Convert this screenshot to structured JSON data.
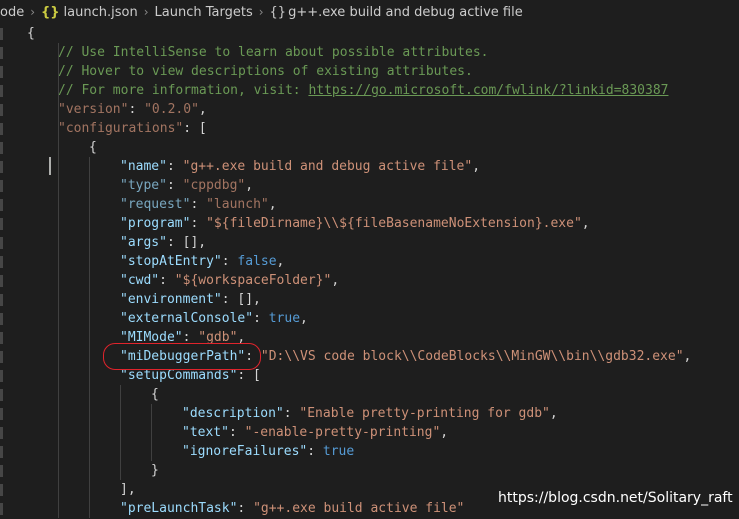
{
  "breadcrumb": {
    "items": [
      "ode",
      "launch.json",
      "Launch Targets",
      "g++.exe build and debug active file"
    ],
    "json_icon": "{}",
    "object_icon": "{}",
    "separator": "›"
  },
  "editor": {
    "lines": [
      {
        "i": 0,
        "p": [
          [
            "punc",
            "{"
          ]
        ]
      },
      {
        "i": 1,
        "p": [
          [
            "cmt",
            "// Use IntelliSense to learn about possible attributes."
          ]
        ]
      },
      {
        "i": 1,
        "p": [
          [
            "cmt",
            "// Hover to view descriptions of existing attributes."
          ]
        ]
      },
      {
        "i": 1,
        "p": [
          [
            "cmt",
            "// For more information, visit: "
          ],
          [
            "link",
            "https://go.microsoft.com/fwlink/?linkid=830387"
          ]
        ]
      },
      {
        "i": 1,
        "p": [
          [
            "str-dim",
            "\"version\""
          ],
          [
            "punc",
            ": "
          ],
          [
            "str-dim",
            "\"0.2.0\""
          ],
          [
            "punc",
            ","
          ]
        ]
      },
      {
        "i": 1,
        "p": [
          [
            "str-dim",
            "\"configurations\""
          ],
          [
            "punc",
            ": ["
          ]
        ]
      },
      {
        "i": 2,
        "p": [
          [
            "punc",
            "{"
          ]
        ]
      },
      {
        "i": 3,
        "p": [
          [
            "key",
            "\"name\""
          ],
          [
            "punc",
            ": "
          ],
          [
            "str",
            "\"g++.exe build and debug active file\""
          ],
          [
            "punc",
            ","
          ]
        ]
      },
      {
        "i": 3,
        "p": [
          [
            "key-dim",
            "\"type\""
          ],
          [
            "punc",
            ": "
          ],
          [
            "str-dim",
            "\"cppdbg\""
          ],
          [
            "punc",
            ","
          ]
        ]
      },
      {
        "i": 3,
        "p": [
          [
            "key-dim",
            "\"request\""
          ],
          [
            "punc",
            ": "
          ],
          [
            "str-dim",
            "\"launch\""
          ],
          [
            "punc",
            ","
          ]
        ]
      },
      {
        "i": 3,
        "p": [
          [
            "key",
            "\"program\""
          ],
          [
            "punc",
            ": "
          ],
          [
            "str",
            "\"${fileDirname}\\\\${fileBasenameNoExtension}.exe\""
          ],
          [
            "punc",
            ","
          ]
        ]
      },
      {
        "i": 3,
        "p": [
          [
            "key",
            "\"args\""
          ],
          [
            "punc",
            ": [],"
          ]
        ]
      },
      {
        "i": 3,
        "p": [
          [
            "key",
            "\"stopAtEntry\""
          ],
          [
            "punc",
            ": "
          ],
          [
            "kw",
            "false"
          ],
          [
            "punc",
            ","
          ]
        ]
      },
      {
        "i": 3,
        "p": [
          [
            "key",
            "\"cwd\""
          ],
          [
            "punc",
            ": "
          ],
          [
            "str",
            "\"${workspaceFolder}\""
          ],
          [
            "punc",
            ","
          ]
        ]
      },
      {
        "i": 3,
        "p": [
          [
            "key",
            "\"environment\""
          ],
          [
            "punc",
            ": [],"
          ]
        ]
      },
      {
        "i": 3,
        "p": [
          [
            "key",
            "\"externalConsole\""
          ],
          [
            "punc",
            ": "
          ],
          [
            "kw",
            "true"
          ],
          [
            "punc",
            ","
          ]
        ]
      },
      {
        "i": 3,
        "p": [
          [
            "key",
            "\"MIMode\""
          ],
          [
            "punc",
            ": "
          ],
          [
            "str",
            "\"gdb\""
          ],
          [
            "punc",
            ","
          ]
        ]
      },
      {
        "i": 3,
        "p": [
          [
            "key",
            "\"miDebuggerPath\""
          ],
          [
            "punc",
            ": "
          ],
          [
            "str",
            "\"D:\\\\VS code block\\\\CodeBlocks\\\\MinGW\\\\bin\\\\gdb32.exe\""
          ],
          [
            "punc",
            ","
          ]
        ]
      },
      {
        "i": 3,
        "p": [
          [
            "key",
            "\"setupCommands\""
          ],
          [
            "punc",
            ": ["
          ]
        ]
      },
      {
        "i": 4,
        "p": [
          [
            "punc",
            "{"
          ]
        ]
      },
      {
        "i": 5,
        "p": [
          [
            "key",
            "\"description\""
          ],
          [
            "punc",
            ": "
          ],
          [
            "str",
            "\"Enable pretty-printing for gdb\""
          ],
          [
            "punc",
            ","
          ]
        ]
      },
      {
        "i": 5,
        "p": [
          [
            "key",
            "\"text\""
          ],
          [
            "punc",
            ": "
          ],
          [
            "str",
            "\"-enable-pretty-printing\""
          ],
          [
            "punc",
            ","
          ]
        ]
      },
      {
        "i": 5,
        "p": [
          [
            "key",
            "\"ignoreFailures\""
          ],
          [
            "punc",
            ": "
          ],
          [
            "kw",
            "true"
          ]
        ]
      },
      {
        "i": 4,
        "p": [
          [
            "punc",
            "}"
          ]
        ]
      },
      {
        "i": 3,
        "p": [
          [
            "punc",
            "],"
          ]
        ]
      },
      {
        "i": 3,
        "p": [
          [
            "key",
            "\"preLaunchTask\""
          ],
          [
            "punc",
            ": "
          ],
          [
            "str",
            "\"g++.exe build active file\""
          ]
        ]
      }
    ]
  },
  "watermark": "https://blog.csdn.net/Solitary_raft"
}
